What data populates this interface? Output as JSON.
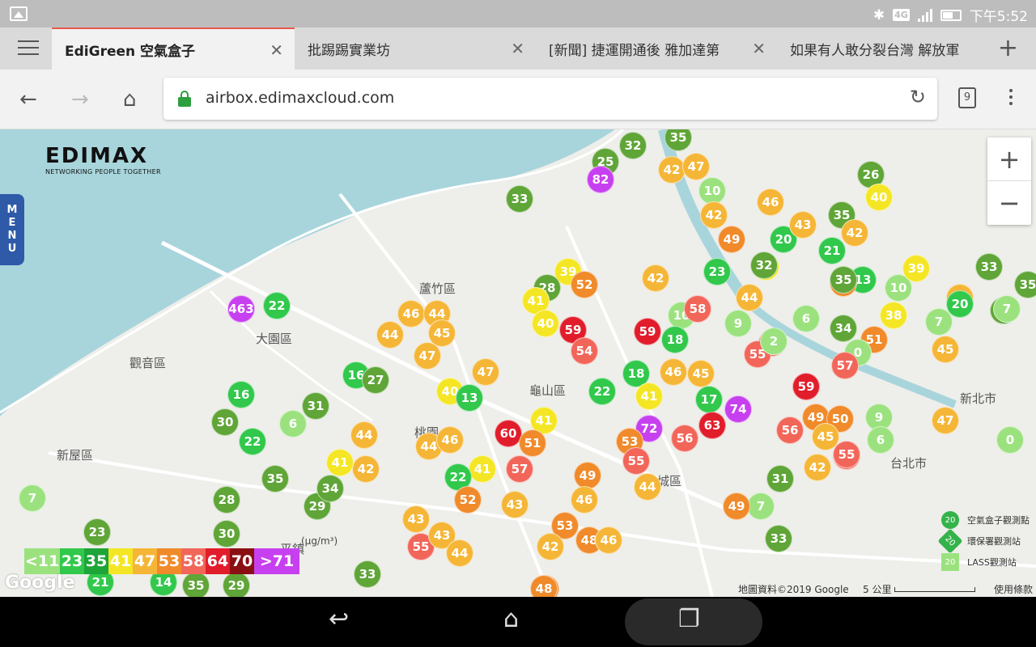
{
  "status": {
    "time": "下午5:52",
    "network": "4G"
  },
  "tabs": [
    {
      "label": "EdiGreen 空氣盒子",
      "active": true
    },
    {
      "label": "批踢踢實業坊",
      "active": false
    },
    {
      "label": "[新聞] 捷運開通後 雅加達第",
      "active": false
    },
    {
      "label": "如果有人敢分裂台灣 解放軍",
      "active": false
    }
  ],
  "toolbar": {
    "url": "airbox.edimaxcloud.com",
    "tab_count": "9"
  },
  "map": {
    "logo": "EDIMAX",
    "logo_tagline": "NETWORKING PEOPLE TOGETHER",
    "menu_label": [
      "M",
      "E",
      "N",
      "U"
    ],
    "districts": [
      "蘆竹區",
      "大園區",
      "觀音區",
      "龜山區",
      "新屋區",
      "桃園",
      "平鎮",
      "新北市",
      "台北市",
      "城區"
    ],
    "legend": {
      "unit": "(μg/m³)",
      "items": [
        {
          "label": "<11",
          "color": "#9be27f"
        },
        {
          "label": "23",
          "color": "#31c84b"
        },
        {
          "label": "35",
          "color": "#1da53a"
        },
        {
          "label": "41",
          "color": "#f4e625"
        },
        {
          "label": "47",
          "color": "#f5b637"
        },
        {
          "label": "53",
          "color": "#f08a2a"
        },
        {
          "label": "58",
          "color": "#f2665a"
        },
        {
          "label": "64",
          "color": "#e11d2b"
        },
        {
          "label": "70",
          "color": "#8a0f12"
        },
        {
          "label": ">71",
          "color": "#c740f0"
        }
      ]
    },
    "station_legend": [
      "空氣盒子觀測點",
      "環保署觀測站",
      "LASS觀測站"
    ],
    "attribution": "地圖資料©2019 Google",
    "scale": "5 公里",
    "terms": "使用條款",
    "google": "Google",
    "markers": [
      {
        "v": "32",
        "c": "#5fa537"
      },
      {
        "v": "35",
        "c": "#5fa537"
      },
      {
        "v": "25",
        "c": "#5fa537"
      },
      {
        "v": "82",
        "c": "#c740f0"
      },
      {
        "v": "42",
        "c": "#f5b637"
      },
      {
        "v": "47",
        "c": "#f5b637"
      },
      {
        "v": "33",
        "c": "#5fa537"
      },
      {
        "v": "26",
        "c": "#5fa537"
      },
      {
        "v": "40",
        "c": "#f4e625"
      },
      {
        "v": "10",
        "c": "#9be27f"
      },
      {
        "v": "46",
        "c": "#f5b637"
      },
      {
        "v": "42",
        "c": "#f08a2a"
      },
      {
        "v": "21",
        "c": "#31c84b"
      },
      {
        "v": "49",
        "c": "#f08a2a"
      },
      {
        "v": "20",
        "c": "#31c84b"
      },
      {
        "v": "43",
        "c": "#f5b637"
      },
      {
        "v": "35",
        "c": "#5fa537"
      },
      {
        "v": "42",
        "c": "#f5b637"
      },
      {
        "v": "463",
        "c": "#c740f0"
      },
      {
        "v": "22",
        "c": "#31c84b"
      },
      {
        "v": "46",
        "c": "#f5b637"
      },
      {
        "v": "44",
        "c": "#f5b637"
      },
      {
        "v": "45",
        "c": "#f5b637"
      },
      {
        "v": "44",
        "c": "#f5b637"
      },
      {
        "v": "47",
        "c": "#f5b637"
      },
      {
        "v": "39",
        "c": "#f4e625"
      },
      {
        "v": "52",
        "c": "#f08a2a"
      },
      {
        "v": "28",
        "c": "#5fa537"
      },
      {
        "v": "41",
        "c": "#f4e625"
      },
      {
        "v": "40",
        "c": "#f4e625"
      },
      {
        "v": "59",
        "c": "#e11d2b"
      },
      {
        "v": "54",
        "c": "#f2665a"
      },
      {
        "v": "42",
        "c": "#f5b637"
      },
      {
        "v": "23",
        "c": "#31c84b"
      },
      {
        "v": "16",
        "c": "#31c84b"
      },
      {
        "v": "27",
        "c": "#5fa537"
      },
      {
        "v": "16",
        "c": "#31c84b"
      },
      {
        "v": "31",
        "c": "#5fa537"
      },
      {
        "v": "30",
        "c": "#5fa537"
      },
      {
        "v": "6",
        "c": "#9be27f"
      },
      {
        "v": "22",
        "c": "#31c84b"
      },
      {
        "v": "40",
        "c": "#f4e625"
      },
      {
        "v": "13",
        "c": "#31c84b"
      },
      {
        "v": "22",
        "c": "#31c84b"
      },
      {
        "v": "41",
        "c": "#f4e625"
      },
      {
        "v": "44",
        "c": "#f5b637"
      },
      {
        "v": "44",
        "c": "#f5b637"
      },
      {
        "v": "60",
        "c": "#e11d2b"
      },
      {
        "v": "51",
        "c": "#f08a2a"
      },
      {
        "v": "46",
        "c": "#f5b637"
      },
      {
        "v": "41",
        "c": "#f4e625"
      },
      {
        "v": "42",
        "c": "#f5b637"
      },
      {
        "v": "35",
        "c": "#5fa537"
      },
      {
        "v": "28",
        "c": "#5fa537"
      },
      {
        "v": "29",
        "c": "#5fa537"
      },
      {
        "v": "34",
        "c": "#5fa537"
      },
      {
        "v": "22",
        "c": "#31c84b"
      },
      {
        "v": "41",
        "c": "#f4e625"
      },
      {
        "v": "57",
        "c": "#f2665a"
      },
      {
        "v": "52",
        "c": "#f08a2a"
      },
      {
        "v": "43",
        "c": "#f5b637"
      },
      {
        "v": "49",
        "c": "#f08a2a"
      },
      {
        "v": "46",
        "c": "#f5b637"
      },
      {
        "v": "43",
        "c": "#f5b637"
      },
      {
        "v": "53",
        "c": "#f08a2a"
      },
      {
        "v": "48",
        "c": "#f08a2a"
      },
      {
        "v": "46",
        "c": "#f5b637"
      },
      {
        "v": "55",
        "c": "#f2665a"
      },
      {
        "v": "43",
        "c": "#f5b637"
      },
      {
        "v": "44",
        "c": "#f5b637"
      },
      {
        "v": "30",
        "c": "#5fa537"
      },
      {
        "v": "23",
        "c": "#5fa537"
      },
      {
        "v": "7",
        "c": "#9be27f"
      },
      {
        "v": "14",
        "c": "#31c84b"
      },
      {
        "v": "21",
        "c": "#31c84b"
      },
      {
        "v": "35",
        "c": "#5fa537"
      },
      {
        "v": "29",
        "c": "#5fa537"
      },
      {
        "v": "33",
        "c": "#5fa537"
      },
      {
        "v": "51",
        "c": "#f08a2a"
      },
      {
        "v": "42",
        "c": "#f5b637"
      },
      {
        "v": "10",
        "c": "#9be27f"
      },
      {
        "v": "18",
        "c": "#31c84b"
      },
      {
        "v": "59",
        "c": "#e11d2b"
      },
      {
        "v": "58",
        "c": "#f2665a"
      },
      {
        "v": "9",
        "c": "#9be27f"
      },
      {
        "v": "44",
        "c": "#f5b637"
      },
      {
        "v": "37",
        "c": "#f4e625"
      },
      {
        "v": "23",
        "c": "#31c84b"
      },
      {
        "v": "55",
        "c": "#f2665a"
      },
      {
        "v": "6",
        "c": "#9be27f"
      },
      {
        "v": "34",
        "c": "#5fa537"
      },
      {
        "v": "12",
        "c": "#31c84b"
      },
      {
        "v": "13",
        "c": "#31c84b"
      },
      {
        "v": "10",
        "c": "#9be27f"
      },
      {
        "v": "39",
        "c": "#f4e625"
      },
      {
        "v": "33",
        "c": "#5fa537"
      },
      {
        "v": "37",
        "c": "#f5b637"
      },
      {
        "v": "20",
        "c": "#31c84b"
      },
      {
        "v": "35",
        "c": "#5fa537"
      },
      {
        "v": "30",
        "c": "#5fa537"
      },
      {
        "v": "38",
        "c": "#f4e625"
      },
      {
        "v": "7",
        "c": "#9be27f"
      },
      {
        "v": "51",
        "c": "#f08a2a"
      },
      {
        "v": "0",
        "c": "#9be27f"
      },
      {
        "v": "57",
        "c": "#f2665a"
      },
      {
        "v": "45",
        "c": "#f5b637"
      },
      {
        "v": "46",
        "c": "#f5b637"
      },
      {
        "v": "45",
        "c": "#f5b637"
      },
      {
        "v": "18",
        "c": "#31c84b"
      },
      {
        "v": "41",
        "c": "#f4e625"
      },
      {
        "v": "22",
        "c": "#31c84b"
      },
      {
        "v": "17",
        "c": "#31c84b"
      },
      {
        "v": "74",
        "c": "#c740f0"
      },
      {
        "v": "72",
        "c": "#c740f0"
      },
      {
        "v": "56",
        "c": "#f2665a"
      },
      {
        "v": "63",
        "c": "#e11d2b"
      },
      {
        "v": "53",
        "c": "#f08a2a"
      },
      {
        "v": "55",
        "c": "#f2665a"
      },
      {
        "v": "59",
        "c": "#e11d2b"
      },
      {
        "v": "56",
        "c": "#f2665a"
      },
      {
        "v": "49",
        "c": "#f08a2a"
      },
      {
        "v": "50",
        "c": "#f08a2a"
      },
      {
        "v": "9",
        "c": "#9be27f"
      },
      {
        "v": "45",
        "c": "#f5b637"
      },
      {
        "v": "6",
        "c": "#9be27f"
      },
      {
        "v": "54",
        "c": "#f2665a"
      },
      {
        "v": "47",
        "c": "#f5b637"
      },
      {
        "v": "0",
        "c": "#9be27f"
      },
      {
        "v": "33",
        "c": "#5fa537"
      },
      {
        "v": "31",
        "c": "#5fa537"
      },
      {
        "v": "7",
        "c": "#9be27f"
      },
      {
        "v": "49",
        "c": "#f08a2a"
      },
      {
        "v": "42",
        "c": "#f5b637"
      },
      {
        "v": "44",
        "c": "#f5b637"
      },
      {
        "v": "42",
        "c": "#f5b637"
      },
      {
        "v": "48",
        "c": "#f08a2a"
      },
      {
        "v": "7",
        "c": "#9be27f"
      },
      {
        "v": "55",
        "c": "#f2665a"
      },
      {
        "v": "2",
        "c": "#9be27f"
      },
      {
        "v": "51",
        "c": "#f08a2a"
      },
      {
        "v": "35",
        "c": "#5fa537"
      },
      {
        "v": "32",
        "c": "#5fa537"
      },
      {
        "v": "55",
        "c": "#f2665a"
      },
      {
        "v": "5",
        "c": "#9be27f"
      },
      {
        "v": "12",
        "c": "#31c84b"
      },
      {
        "v": "37",
        "c": "#f5b637"
      },
      {
        "v": "47",
        "c": "#f5b637"
      }
    ]
  }
}
